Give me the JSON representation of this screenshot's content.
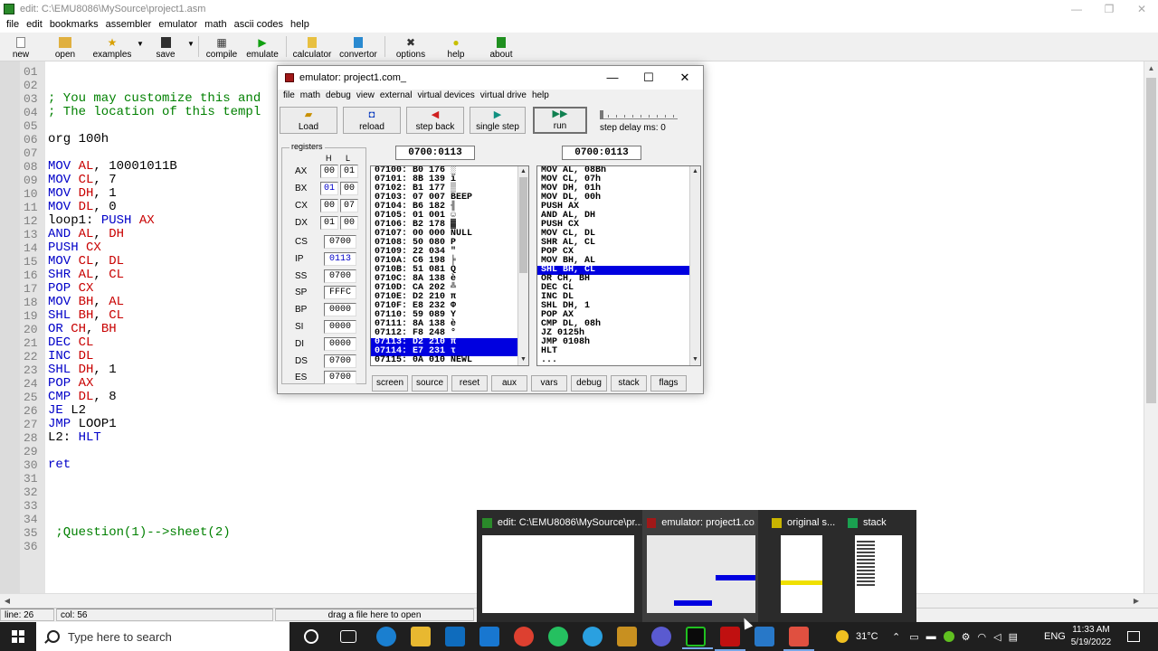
{
  "editor": {
    "title": "edit: C:\\EMU8086\\MySource\\project1.asm",
    "menu": [
      "file",
      "edit",
      "bookmarks",
      "assembler",
      "emulator",
      "math",
      "ascii codes",
      "help"
    ],
    "toolbar": {
      "new": "new",
      "open": "open",
      "examples": "examples",
      "save": "save",
      "compile": "compile",
      "emulate": "emulate",
      "calculator": "calculator",
      "convertor": "convertor",
      "options": "options",
      "help": "help",
      "about": "about"
    },
    "lines": [
      {
        "n": "01",
        "tokens": []
      },
      {
        "n": "02",
        "tokens": []
      },
      {
        "n": "03",
        "tokens": [
          {
            "t": "; You may customize this and",
            "c": "cm"
          }
        ]
      },
      {
        "n": "04",
        "tokens": [
          {
            "t": "; The location of this templ",
            "c": "cm"
          }
        ]
      },
      {
        "n": "05",
        "tokens": []
      },
      {
        "n": "06",
        "tokens": [
          {
            "t": "org 100h",
            "c": "plain"
          }
        ]
      },
      {
        "n": "07",
        "tokens": []
      },
      {
        "n": "08",
        "tokens": [
          {
            "t": "MOV ",
            "c": "kw"
          },
          {
            "t": "AL",
            "c": "reg"
          },
          {
            "t": ", 10001011B",
            "c": "plain"
          }
        ]
      },
      {
        "n": "09",
        "tokens": [
          {
            "t": "MOV ",
            "c": "kw"
          },
          {
            "t": "CL",
            "c": "reg"
          },
          {
            "t": ", 7",
            "c": "plain"
          }
        ]
      },
      {
        "n": "10",
        "tokens": [
          {
            "t": "MOV ",
            "c": "kw"
          },
          {
            "t": "DH",
            "c": "reg"
          },
          {
            "t": ", 1",
            "c": "plain"
          }
        ]
      },
      {
        "n": "11",
        "tokens": [
          {
            "t": "MOV ",
            "c": "kw"
          },
          {
            "t": "DL",
            "c": "reg"
          },
          {
            "t": ", 0",
            "c": "plain"
          }
        ]
      },
      {
        "n": "12",
        "tokens": [
          {
            "t": "loop1: ",
            "c": "plain"
          },
          {
            "t": "PUSH ",
            "c": "kw"
          },
          {
            "t": "AX",
            "c": "reg"
          }
        ]
      },
      {
        "n": "13",
        "tokens": [
          {
            "t": "AND ",
            "c": "kw"
          },
          {
            "t": "AL",
            "c": "reg"
          },
          {
            "t": ", ",
            "c": "plain"
          },
          {
            "t": "DH",
            "c": "reg"
          }
        ]
      },
      {
        "n": "14",
        "tokens": [
          {
            "t": "PUSH ",
            "c": "kw"
          },
          {
            "t": "CX",
            "c": "reg"
          }
        ]
      },
      {
        "n": "15",
        "tokens": [
          {
            "t": "MOV ",
            "c": "kw"
          },
          {
            "t": "CL",
            "c": "reg"
          },
          {
            "t": ", ",
            "c": "plain"
          },
          {
            "t": "DL",
            "c": "reg"
          }
        ]
      },
      {
        "n": "16",
        "tokens": [
          {
            "t": "SHR ",
            "c": "kw"
          },
          {
            "t": "AL",
            "c": "reg"
          },
          {
            "t": ", ",
            "c": "plain"
          },
          {
            "t": "CL",
            "c": "reg"
          }
        ]
      },
      {
        "n": "17",
        "tokens": [
          {
            "t": "POP ",
            "c": "kw"
          },
          {
            "t": "CX",
            "c": "reg"
          }
        ]
      },
      {
        "n": "18",
        "tokens": [
          {
            "t": "MOV ",
            "c": "kw"
          },
          {
            "t": "BH",
            "c": "reg"
          },
          {
            "t": ", ",
            "c": "plain"
          },
          {
            "t": "AL",
            "c": "reg"
          }
        ]
      },
      {
        "n": "19",
        "tokens": [
          {
            "t": "SHL ",
            "c": "kw"
          },
          {
            "t": "BH",
            "c": "reg"
          },
          {
            "t": ", ",
            "c": "plain"
          },
          {
            "t": "CL",
            "c": "reg"
          }
        ]
      },
      {
        "n": "20",
        "tokens": [
          {
            "t": "OR ",
            "c": "kw"
          },
          {
            "t": "CH",
            "c": "reg"
          },
          {
            "t": ", ",
            "c": "plain"
          },
          {
            "t": "BH",
            "c": "reg"
          }
        ]
      },
      {
        "n": "21",
        "tokens": [
          {
            "t": "DEC ",
            "c": "kw"
          },
          {
            "t": "CL",
            "c": "reg"
          }
        ]
      },
      {
        "n": "22",
        "tokens": [
          {
            "t": "INC ",
            "c": "kw"
          },
          {
            "t": "DL",
            "c": "reg"
          }
        ]
      },
      {
        "n": "23",
        "tokens": [
          {
            "t": "SHL ",
            "c": "kw"
          },
          {
            "t": "DH",
            "c": "reg"
          },
          {
            "t": ", 1",
            "c": "plain"
          }
        ]
      },
      {
        "n": "24",
        "tokens": [
          {
            "t": "POP ",
            "c": "kw"
          },
          {
            "t": "AX",
            "c": "reg"
          }
        ]
      },
      {
        "n": "25",
        "tokens": [
          {
            "t": "CMP ",
            "c": "kw"
          },
          {
            "t": "DL",
            "c": "reg"
          },
          {
            "t": ", 8",
            "c": "plain"
          }
        ]
      },
      {
        "n": "26",
        "tokens": [
          {
            "t": "JE ",
            "c": "kw"
          },
          {
            "t": "L2",
            "c": "plain"
          }
        ]
      },
      {
        "n": "27",
        "tokens": [
          {
            "t": "JMP ",
            "c": "kw"
          },
          {
            "t": "LOOP1",
            "c": "plain"
          }
        ]
      },
      {
        "n": "28",
        "tokens": [
          {
            "t": "L2: ",
            "c": "plain"
          },
          {
            "t": "HLT",
            "c": "kw"
          }
        ]
      },
      {
        "n": "29",
        "tokens": []
      },
      {
        "n": "30",
        "tokens": [
          {
            "t": "ret",
            "c": "kw"
          }
        ]
      },
      {
        "n": "31",
        "tokens": []
      },
      {
        "n": "32",
        "tokens": []
      },
      {
        "n": "33",
        "tokens": []
      },
      {
        "n": "34",
        "tokens": []
      },
      {
        "n": "35",
        "tokens": [
          {
            "t": " ;Question(1)-->sheet(2)",
            "c": "cm"
          }
        ]
      },
      {
        "n": "36",
        "tokens": []
      }
    ],
    "status": {
      "line": "line: 26",
      "col": "col: 56",
      "hint": "drag a file here to open"
    }
  },
  "emulator": {
    "title": "emulator: project1.com_",
    "menu": [
      "file",
      "math",
      "debug",
      "view",
      "external",
      "virtual devices",
      "virtual drive",
      "help"
    ],
    "buttons": {
      "load": "Load",
      "reload": "reload",
      "step_back": "step back",
      "single_step": "single step",
      "run": "run"
    },
    "step_delay": "step delay ms: 0",
    "registers_label": "registers",
    "hl": {
      "h": "H",
      "l": "L"
    },
    "gp_regs": [
      {
        "name": "AX",
        "h": "00",
        "l": "01"
      },
      {
        "name": "BX",
        "h": "01",
        "l": "00"
      },
      {
        "name": "CX",
        "h": "00",
        "l": "07"
      },
      {
        "name": "DX",
        "h": "01",
        "l": "00"
      }
    ],
    "seg_regs": [
      {
        "name": "CS",
        "v": "0700"
      },
      {
        "name": "IP",
        "v": "0113"
      },
      {
        "name": "SS",
        "v": "0700"
      },
      {
        "name": "SP",
        "v": "FFFC"
      },
      {
        "name": "BP",
        "v": "0000"
      },
      {
        "name": "SI",
        "v": "0000"
      },
      {
        "name": "DI",
        "v": "0000"
      },
      {
        "name": "DS",
        "v": "0700"
      },
      {
        "name": "ES",
        "v": "0700"
      }
    ],
    "addr_left": "0700:0113",
    "addr_right": "0700:0113",
    "memory": [
      "07100: B0 176 ░",
      "07101: 8B 139 ï",
      "07102: B1 177 ▒",
      "07103: 07 007 BEEP",
      "07104: B6 182 ╢",
      "07105: 01 001 ☺",
      "07106: B2 178 ▓",
      "07107: 00 000 NULL",
      "07108: 50 080 P",
      "07109: 22 034 \"",
      "0710A: C6 198 ╞",
      "0710B: 51 081 Q",
      "0710C: 8A 138 è",
      "0710D: CA 202 ╩",
      "0710E: D2 210 π",
      "0710F: E8 232 Φ",
      "07110: 59 089 Y",
      "07111: 8A 138 è",
      "07112: F8 248 °",
      "07113: D2 210 π",
      "07114: E7 231 τ",
      "07115: 0A 010 NEWL"
    ],
    "memory_selected": [
      19,
      20
    ],
    "disasm": [
      "MOV AL, 08Bh",
      "MOV CL, 07h",
      "MOV DH, 01h",
      "MOV DL, 00h",
      "PUSH AX",
      "AND AL, DH",
      "PUSH CX",
      "MOV CL, DL",
      "SHR AL, CL",
      "POP CX",
      "MOV BH, AL",
      "SHL BH, CL",
      "OR CH, BH",
      "DEC CL",
      "INC DL",
      "SHL DH, 1",
      "POP AX",
      "CMP DL, 08h",
      "JZ 0125h",
      "JMP 0108h",
      "HLT",
      "..."
    ],
    "disasm_selected": 11,
    "bottom": [
      "screen",
      "source",
      "reset",
      "aux",
      "vars",
      "debug",
      "stack",
      "flags"
    ]
  },
  "previews": [
    {
      "title": "edit: C:\\EMU8086\\MySource\\pr...",
      "icon_color": "#2a8a2a"
    },
    {
      "title": "emulator: project1.co...",
      "icon_color": "#a01818"
    },
    {
      "title": "original s...",
      "icon_color": "#c8b400"
    },
    {
      "title": "stack",
      "icon_color": "#1aa050"
    }
  ],
  "taskbar": {
    "search_placeholder": "Type here to search",
    "temperature": "31°C",
    "lang": "ENG",
    "time": "11:33 AM",
    "date": "5/19/2022"
  }
}
